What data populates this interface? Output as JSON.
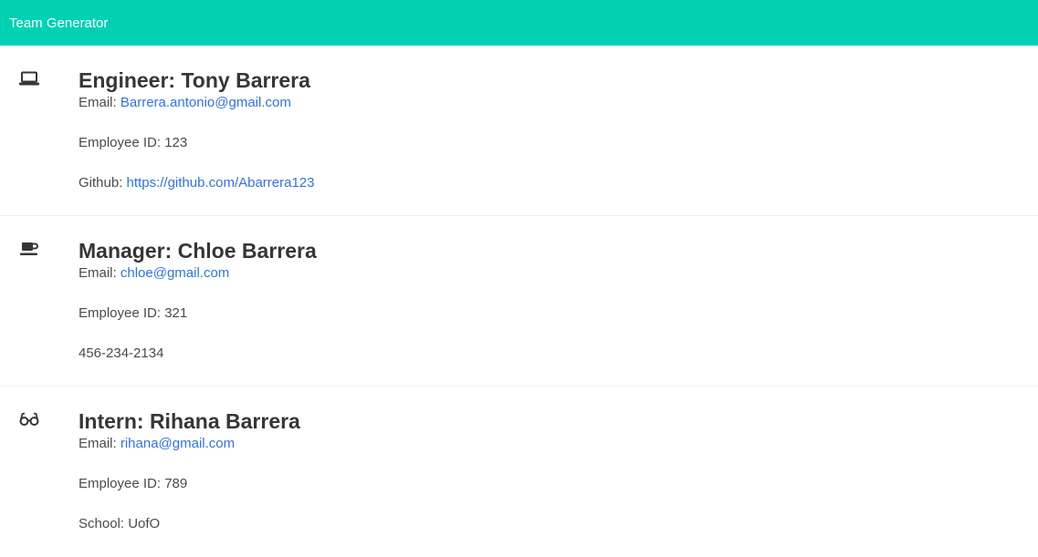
{
  "navbar": {
    "title": "Team Generator"
  },
  "colors": {
    "navbar": "#00d1b2",
    "link": "#3273dc"
  },
  "employees": [
    {
      "icon": "laptop-icon",
      "title": "Engineer: Tony Barrera",
      "email_label": "Email:",
      "email": "Barrera.antonio@gmail.com",
      "id_text": "Employee ID: 123",
      "extra_label": "Github:",
      "extra_value": "https://github.com/Abarrera123"
    },
    {
      "icon": "coffee-icon",
      "title": "Manager: Chloe Barrera",
      "email_label": "Email:",
      "email": "chloe@gmail.com",
      "id_text": "Employee ID: 321",
      "extra_label": "",
      "extra_value": "456-234-2134"
    },
    {
      "icon": "glasses-icon",
      "title": "Intern: Rihana Barrera",
      "email_label": "Email:",
      "email": "rihana@gmail.com",
      "id_text": "Employee ID: 789",
      "extra_label": "School:",
      "extra_value": "UofO"
    }
  ]
}
